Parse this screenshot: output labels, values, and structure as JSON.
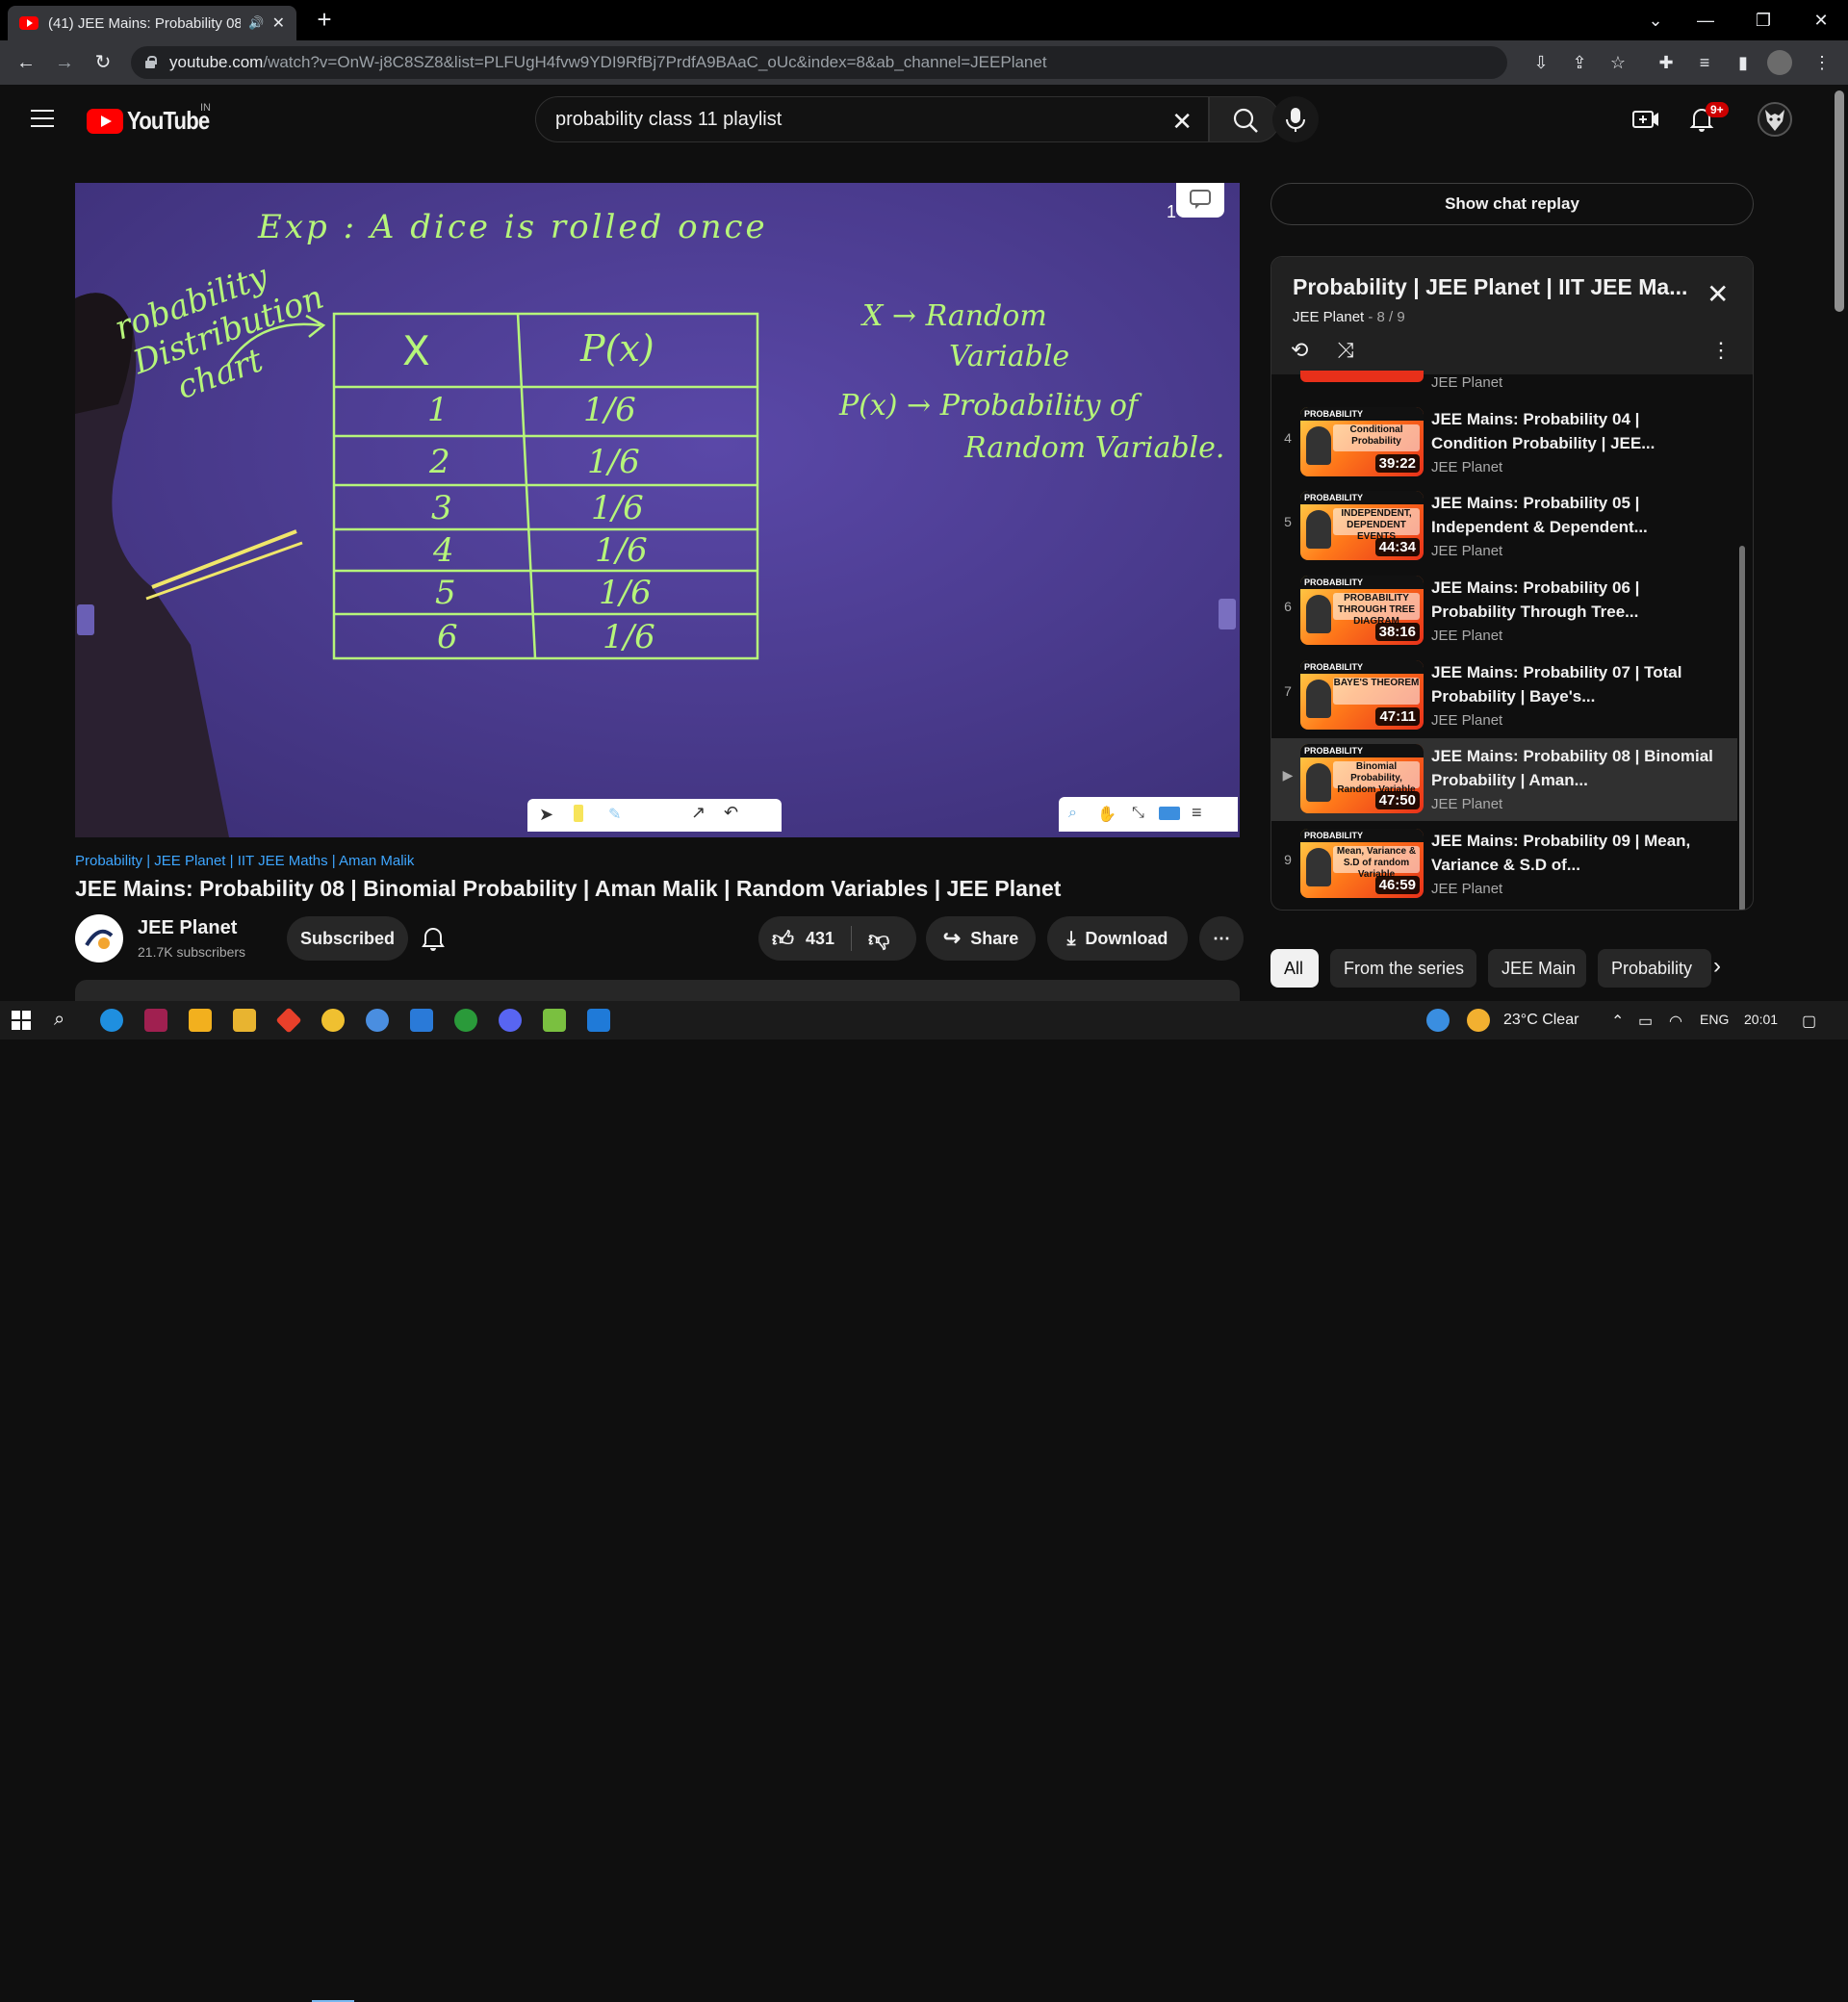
{
  "browser": {
    "tab_title": "(41) JEE Mains: Probability 08",
    "url_host": "youtube.com",
    "url_path": "/watch?v=OnW-j8C8SZ8&list=PLFUgH4fvw9YDI9RfBj7PrdfA9BAaC_oUc&index=8&ab_channel=JEEPlanet"
  },
  "youtube": {
    "logo_text": "YouTube",
    "country": "IN",
    "search_value": "probability class 11 playlist",
    "notif_badge": "9+"
  },
  "video": {
    "board_title": "Exp : A dice is rolled once",
    "left_label": [
      "robability",
      "Distribution",
      "chart"
    ],
    "table_headers": [
      "X",
      "P(x)"
    ],
    "table_rows": [
      [
        "1",
        "1/6"
      ],
      [
        "2",
        "1/6"
      ],
      [
        "3",
        "1/6"
      ],
      [
        "4",
        "1/6"
      ],
      [
        "5",
        "1/6"
      ],
      [
        "6",
        "1/6"
      ]
    ],
    "note1": [
      "X → Random",
      "Variable"
    ],
    "note2": [
      "P(x) → Probability of",
      "Random Variable."
    ],
    "page_number": "1"
  },
  "info": {
    "hashtags": "Probability | JEE Planet | IIT JEE Maths | Aman Malik",
    "title": "JEE Mains: Probability 08 | Binomial Probability | Aman Malik | Random Variables | JEE Planet",
    "channel": "JEE Planet",
    "subscribers": "21.7K subscribers",
    "subscribed_label": "Subscribed",
    "likes": "431",
    "share_label": "Share",
    "download_label": "Download"
  },
  "side": {
    "chat_replay": "Show chat replay",
    "playlist_title": "Probability | JEE Planet | IIT JEE Ma...",
    "playlist_channel": "JEE Planet",
    "playlist_position": " - 8 / 9",
    "top_partial_channel": "JEE Planet",
    "items": [
      {
        "index": "4",
        "title": "JEE Mains: Probability 04 | Condition Probability | JEE...",
        "channel": "JEE Planet",
        "duration": "39:22",
        "topic": "Conditional Probability"
      },
      {
        "index": "5",
        "title": "JEE Mains: Probability 05 | Independent & Dependent...",
        "channel": "JEE Planet",
        "duration": "44:34",
        "topic": "INDEPENDENT, DEPENDENT EVENTS"
      },
      {
        "index": "6",
        "title": "JEE Mains: Probability 06 | Probability Through Tree...",
        "channel": "JEE Planet",
        "duration": "38:16",
        "topic": "PROBABILITY THROUGH TREE DIAGRAM"
      },
      {
        "index": "7",
        "title": "JEE Mains: Probability 07 | Total Probability | Baye's...",
        "channel": "JEE Planet",
        "duration": "47:11",
        "topic": "BAYE'S THEOREM"
      },
      {
        "index": "▶",
        "title": "JEE Mains: Probability 08 | Binomial Probability | Aman...",
        "channel": "JEE Planet",
        "duration": "47:50",
        "topic": "Binomial Probability, Random Variable"
      },
      {
        "index": "9",
        "title": "JEE Mains: Probability 09 | Mean, Variance & S.D of...",
        "channel": "JEE Planet",
        "duration": "46:59",
        "topic": "Mean, Variance & S.D of random Variable"
      }
    ],
    "thumb_brand": "PROBABILITY",
    "chips": [
      "All",
      "From the series",
      "JEE Main",
      "Probability"
    ]
  },
  "taskbar": {
    "weather": "23°C Clear",
    "lang": "ENG",
    "time": "20:01"
  }
}
